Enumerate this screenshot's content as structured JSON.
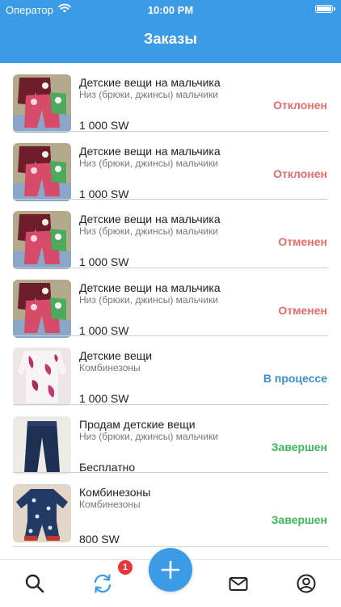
{
  "status_bar": {
    "carrier": "Оператор",
    "time": "10:00 PM"
  },
  "header": {
    "title": "Заказы"
  },
  "orders": [
    {
      "name": "Детские вещи на мальчика",
      "category": "Низ (брюки, джинсы) мальчики",
      "price": "1 000 SW",
      "status": "Отклонен",
      "status_color": "#e86a6a",
      "image": "pants"
    },
    {
      "name": "Детские вещи на мальчика",
      "category": "Низ (брюки, джинсы) мальчики",
      "price": "1 000 SW",
      "status": "Отклонен",
      "status_color": "#e86a6a",
      "image": "pants"
    },
    {
      "name": "Детские вещи на мальчика",
      "category": "Низ (брюки, джинсы) мальчики",
      "price": "1 000 SW",
      "status": "Отменен",
      "status_color": "#e86a6a",
      "image": "pants"
    },
    {
      "name": "Детские вещи на мальчика",
      "category": "Низ (брюки, джинсы) мальчики",
      "price": "1 000 SW",
      "status": "Отменен",
      "status_color": "#e86a6a",
      "image": "pants"
    },
    {
      "name": "Детские вещи",
      "category": "Комбинезоны",
      "price": "1 000 SW",
      "status": "В процессе",
      "status_color": "#3a8fd0",
      "image": "pink-jumpsuit"
    },
    {
      "name": "Продам детские вещи",
      "category": "Низ (брюки, джинсы) мальчики",
      "price": "Бесплатно",
      "status": "Завершен",
      "status_color": "#3bb85a",
      "image": "navy-pants"
    },
    {
      "name": "Комбинезоны",
      "category": "Комбинезоны",
      "price": "800 SW",
      "status": "Завершен",
      "status_color": "#3bb85a",
      "image": "romper"
    }
  ],
  "tabbar": {
    "tabs": [
      "search-icon",
      "sync-icon",
      "plus-icon",
      "mail-icon",
      "profile-icon"
    ],
    "badge": "1",
    "accent": "#3c9be6"
  }
}
